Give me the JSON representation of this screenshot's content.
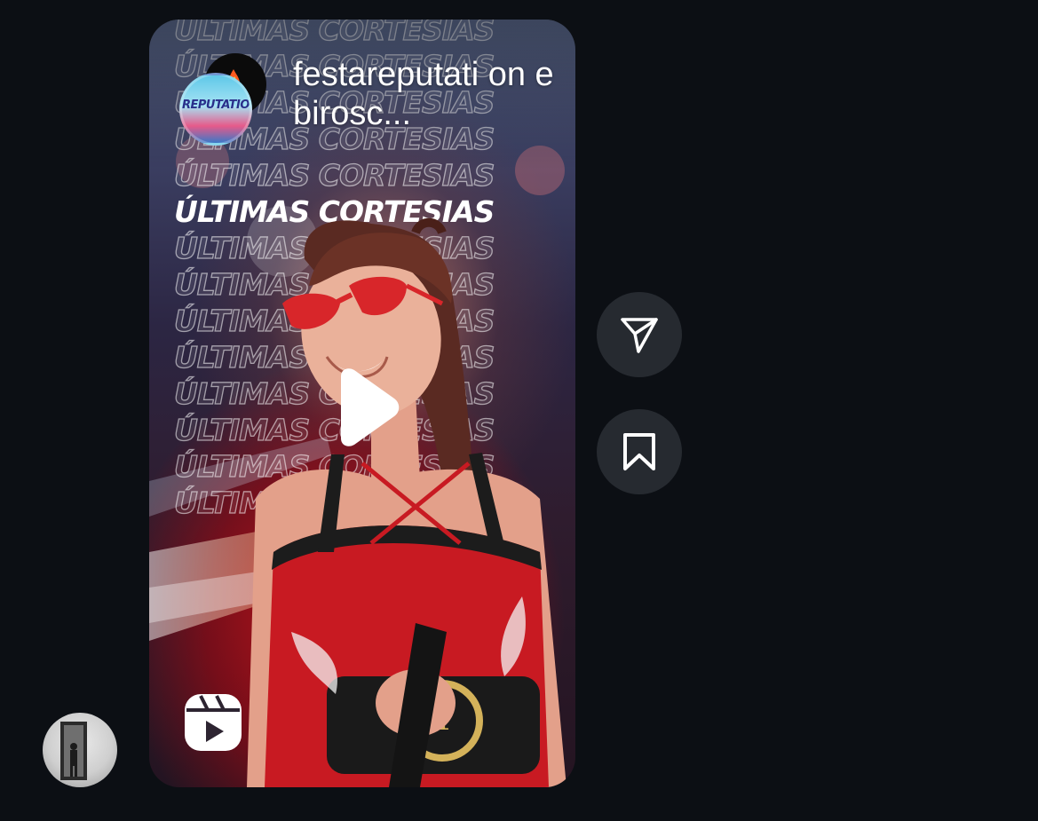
{
  "reel": {
    "username": "festareputati on e birosc...",
    "background_headline": "ÚLTIMAS CORTESIAS",
    "avatar_logo_text": "REPUTATION",
    "type_icon": "reels-icon",
    "media_control_icon": "play-icon"
  },
  "actions": {
    "share_icon": "send-icon",
    "save_icon": "bookmark-icon"
  },
  "sender": {
    "avatar_icon": "profile-photo"
  },
  "colors": {
    "background": "#0c0f14",
    "action_button": "#262a30",
    "text": "#ffffff"
  }
}
